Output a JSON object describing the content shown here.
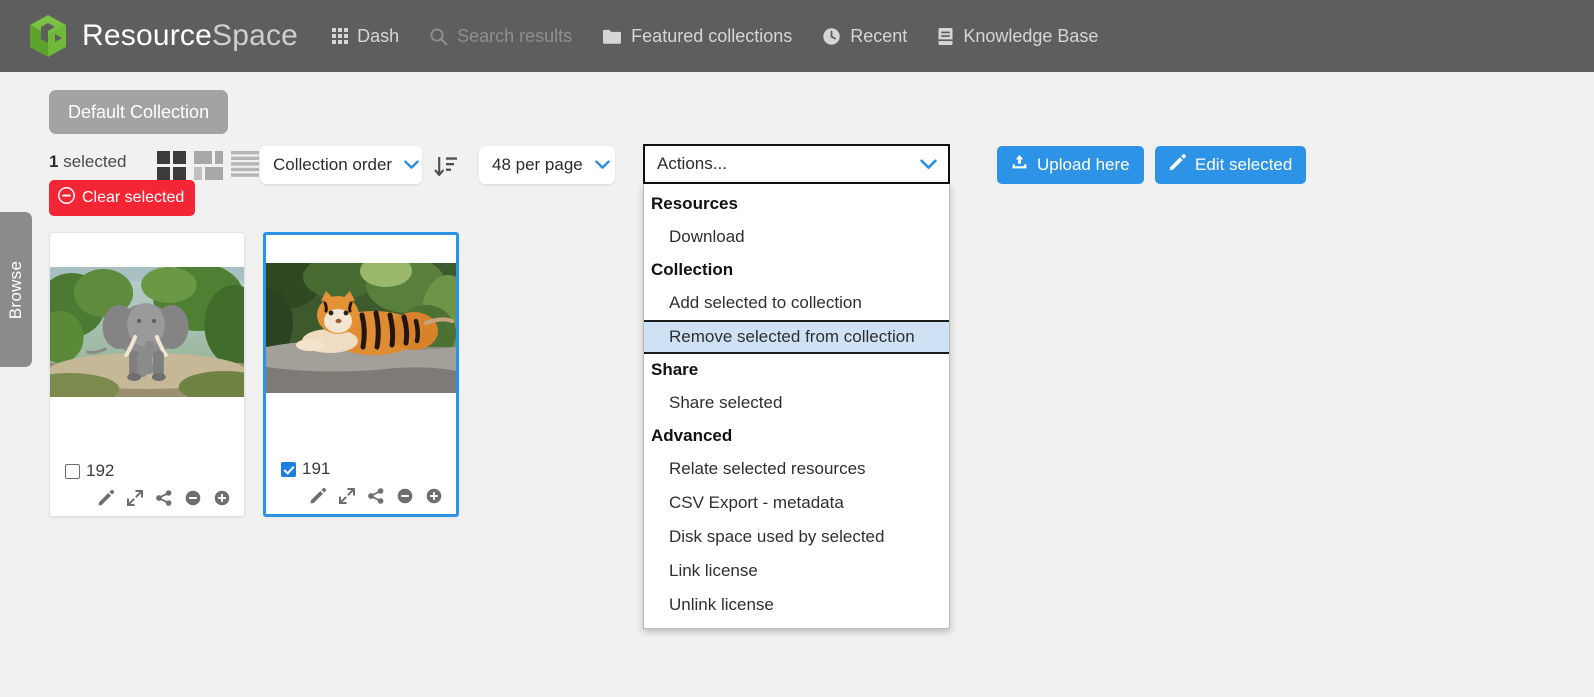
{
  "header": {
    "brand_first": "Resource",
    "brand_second": "Space",
    "logo_icon": "resourcespace-cube-logo",
    "bg_color": "#5e5e5e",
    "nav": [
      {
        "label": "Dash",
        "icon": "grid-icon",
        "muted": false
      },
      {
        "label": "Search results",
        "icon": "search-icon",
        "muted": true
      },
      {
        "label": "Featured collections",
        "icon": "folder-icon",
        "muted": false
      },
      {
        "label": "Recent",
        "icon": "clock-icon",
        "muted": false
      },
      {
        "label": "Knowledge Base",
        "icon": "book-icon",
        "muted": false
      }
    ]
  },
  "browse_tab": {
    "label": "Browse"
  },
  "collection": {
    "pill_label": "Default Collection"
  },
  "toolbar": {
    "selected_count": "1",
    "selected_suffix": " selected",
    "clear_selected_label": "Clear selected",
    "clear_selected_icon": "minus-circle-icon",
    "clear_selected_color": "#f42534",
    "view_modes": [
      {
        "name": "grid-view",
        "active": true
      },
      {
        "name": "mixed-grid-view",
        "active": false
      },
      {
        "name": "list-view",
        "active": false
      }
    ],
    "order_select": {
      "value": "Collection order",
      "caret_icon": "chevron-down-icon"
    },
    "sort_direction_icon": "sort-descending-icon",
    "per_page_select": {
      "value": "48 per page",
      "caret_icon": "chevron-down-icon"
    },
    "upload_button": {
      "label": "Upload here",
      "icon": "upload-icon"
    },
    "edit_button": {
      "label": "Edit selected",
      "icon": "pencil-icon"
    },
    "button_color": "#2d93e6"
  },
  "actions_dropdown": {
    "placeholder": "Actions...",
    "caret_icon": "chevron-down-icon",
    "open": true,
    "highlight_color": "#cfe2f5",
    "groups": [
      {
        "group": "Resources",
        "items": [
          "Download"
        ]
      },
      {
        "group": "Collection",
        "items": [
          "Add selected to collection",
          "Remove selected from collection"
        ]
      },
      {
        "group": "Share",
        "items": [
          "Share selected"
        ]
      },
      {
        "group": "Advanced",
        "items": [
          "Relate selected resources",
          "CSV Export - metadata",
          "Disk space used by selected",
          "Link license",
          "Unlink license"
        ]
      }
    ],
    "highlighted_item": "Remove selected from collection"
  },
  "resources": [
    {
      "id": "192",
      "checked": false,
      "thumbnail": "elephant-photo",
      "icons": [
        "pencil-icon",
        "expand-icon",
        "share-icon",
        "minus-circle-icon",
        "plus-circle-icon"
      ]
    },
    {
      "id": "191",
      "checked": true,
      "thumbnail": "tiger-photo",
      "icons": [
        "pencil-icon",
        "expand-icon",
        "share-icon",
        "minus-circle-icon",
        "plus-circle-icon"
      ]
    }
  ]
}
